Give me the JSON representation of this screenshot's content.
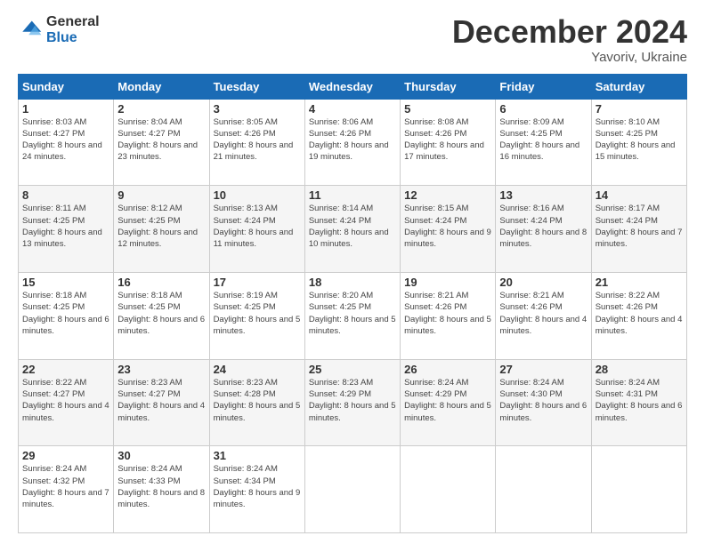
{
  "logo": {
    "general": "General",
    "blue": "Blue"
  },
  "header": {
    "month": "December 2024",
    "location": "Yavoriv, Ukraine"
  },
  "weekdays": [
    "Sunday",
    "Monday",
    "Tuesday",
    "Wednesday",
    "Thursday",
    "Friday",
    "Saturday"
  ],
  "weeks": [
    [
      {
        "day": "1",
        "sunrise": "8:03 AM",
        "sunset": "4:27 PM",
        "daylight": "8 hours and 24 minutes."
      },
      {
        "day": "2",
        "sunrise": "8:04 AM",
        "sunset": "4:27 PM",
        "daylight": "8 hours and 23 minutes."
      },
      {
        "day": "3",
        "sunrise": "8:05 AM",
        "sunset": "4:26 PM",
        "daylight": "8 hours and 21 minutes."
      },
      {
        "day": "4",
        "sunrise": "8:06 AM",
        "sunset": "4:26 PM",
        "daylight": "8 hours and 19 minutes."
      },
      {
        "day": "5",
        "sunrise": "8:08 AM",
        "sunset": "4:26 PM",
        "daylight": "8 hours and 17 minutes."
      },
      {
        "day": "6",
        "sunrise": "8:09 AM",
        "sunset": "4:25 PM",
        "daylight": "8 hours and 16 minutes."
      },
      {
        "day": "7",
        "sunrise": "8:10 AM",
        "sunset": "4:25 PM",
        "daylight": "8 hours and 15 minutes."
      }
    ],
    [
      {
        "day": "8",
        "sunrise": "8:11 AM",
        "sunset": "4:25 PM",
        "daylight": "8 hours and 13 minutes."
      },
      {
        "day": "9",
        "sunrise": "8:12 AM",
        "sunset": "4:25 PM",
        "daylight": "8 hours and 12 minutes."
      },
      {
        "day": "10",
        "sunrise": "8:13 AM",
        "sunset": "4:24 PM",
        "daylight": "8 hours and 11 minutes."
      },
      {
        "day": "11",
        "sunrise": "8:14 AM",
        "sunset": "4:24 PM",
        "daylight": "8 hours and 10 minutes."
      },
      {
        "day": "12",
        "sunrise": "8:15 AM",
        "sunset": "4:24 PM",
        "daylight": "8 hours and 9 minutes."
      },
      {
        "day": "13",
        "sunrise": "8:16 AM",
        "sunset": "4:24 PM",
        "daylight": "8 hours and 8 minutes."
      },
      {
        "day": "14",
        "sunrise": "8:17 AM",
        "sunset": "4:24 PM",
        "daylight": "8 hours and 7 minutes."
      }
    ],
    [
      {
        "day": "15",
        "sunrise": "8:18 AM",
        "sunset": "4:25 PM",
        "daylight": "8 hours and 6 minutes."
      },
      {
        "day": "16",
        "sunrise": "8:18 AM",
        "sunset": "4:25 PM",
        "daylight": "8 hours and 6 minutes."
      },
      {
        "day": "17",
        "sunrise": "8:19 AM",
        "sunset": "4:25 PM",
        "daylight": "8 hours and 5 minutes."
      },
      {
        "day": "18",
        "sunrise": "8:20 AM",
        "sunset": "4:25 PM",
        "daylight": "8 hours and 5 minutes."
      },
      {
        "day": "19",
        "sunrise": "8:21 AM",
        "sunset": "4:26 PM",
        "daylight": "8 hours and 5 minutes."
      },
      {
        "day": "20",
        "sunrise": "8:21 AM",
        "sunset": "4:26 PM",
        "daylight": "8 hours and 4 minutes."
      },
      {
        "day": "21",
        "sunrise": "8:22 AM",
        "sunset": "4:26 PM",
        "daylight": "8 hours and 4 minutes."
      }
    ],
    [
      {
        "day": "22",
        "sunrise": "8:22 AM",
        "sunset": "4:27 PM",
        "daylight": "8 hours and 4 minutes."
      },
      {
        "day": "23",
        "sunrise": "8:23 AM",
        "sunset": "4:27 PM",
        "daylight": "8 hours and 4 minutes."
      },
      {
        "day": "24",
        "sunrise": "8:23 AM",
        "sunset": "4:28 PM",
        "daylight": "8 hours and 5 minutes."
      },
      {
        "day": "25",
        "sunrise": "8:23 AM",
        "sunset": "4:29 PM",
        "daylight": "8 hours and 5 minutes."
      },
      {
        "day": "26",
        "sunrise": "8:24 AM",
        "sunset": "4:29 PM",
        "daylight": "8 hours and 5 minutes."
      },
      {
        "day": "27",
        "sunrise": "8:24 AM",
        "sunset": "4:30 PM",
        "daylight": "8 hours and 6 minutes."
      },
      {
        "day": "28",
        "sunrise": "8:24 AM",
        "sunset": "4:31 PM",
        "daylight": "8 hours and 6 minutes."
      }
    ],
    [
      {
        "day": "29",
        "sunrise": "8:24 AM",
        "sunset": "4:32 PM",
        "daylight": "8 hours and 7 minutes."
      },
      {
        "day": "30",
        "sunrise": "8:24 AM",
        "sunset": "4:33 PM",
        "daylight": "8 hours and 8 minutes."
      },
      {
        "day": "31",
        "sunrise": "8:24 AM",
        "sunset": "4:34 PM",
        "daylight": "8 hours and 9 minutes."
      },
      null,
      null,
      null,
      null
    ]
  ],
  "labels": {
    "sunrise": "Sunrise:",
    "sunset": "Sunset:",
    "daylight": "Daylight:"
  }
}
